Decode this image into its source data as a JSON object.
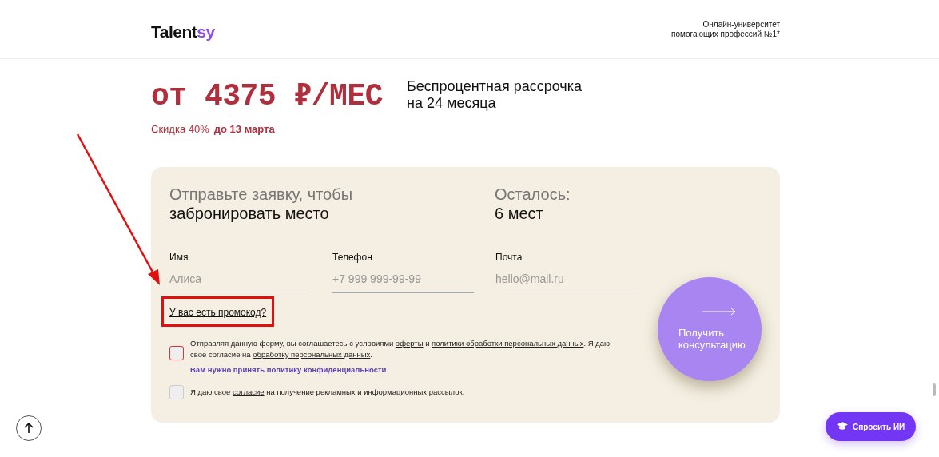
{
  "header": {
    "logo": {
      "main": "Talent",
      "accent": "sy"
    },
    "tagline": [
      "Онлайн-университет",
      "помогающих профессий №1*"
    ]
  },
  "price": {
    "amount": "от 4375 ₽/МЕС",
    "installment": [
      "Беспроцентная рассрочка",
      "на 24 месяца"
    ],
    "discount": "Скидка 40%",
    "deadline": "до 13 марта"
  },
  "form": {
    "title_light": "Отправьте заявку, чтобы",
    "title_bold": "забронировать место",
    "remaining_label": "Осталось:",
    "remaining_value": "6 мест",
    "fields": [
      {
        "label": "Имя",
        "placeholder": "Алиса"
      },
      {
        "label": "Телефон",
        "placeholder": "+7 999 999-99-99"
      },
      {
        "label": "Почта",
        "placeholder": "hello@mail.ru"
      }
    ],
    "promo_link": "У вас есть промокод?",
    "consents": [
      {
        "checked": false,
        "error": true,
        "parts": [
          {
            "text": "Отправляя данную форму, вы соглашаетесь с условиями ",
            "link": false
          },
          {
            "text": "оферты",
            "link": true
          },
          {
            "text": " и ",
            "link": false
          },
          {
            "text": "политики обработки персональных данных",
            "link": true
          },
          {
            "text": ". Я даю свое согласие на ",
            "link": false
          },
          {
            "text": "обработку персональных данных",
            "link": true
          },
          {
            "text": ".",
            "link": false
          }
        ],
        "error_text": "Вам нужно принять политику конфиденциальности"
      },
      {
        "checked": false,
        "error": false,
        "parts": [
          {
            "text": "Я даю свое ",
            "link": false
          },
          {
            "text": "согласие",
            "link": true
          },
          {
            "text": " на получение рекламных и информационных рассылок.",
            "link": false
          }
        ]
      }
    ],
    "submit": [
      "Получить",
      "консультацию"
    ]
  },
  "ask_ai_button": "Спросить ИИ"
}
